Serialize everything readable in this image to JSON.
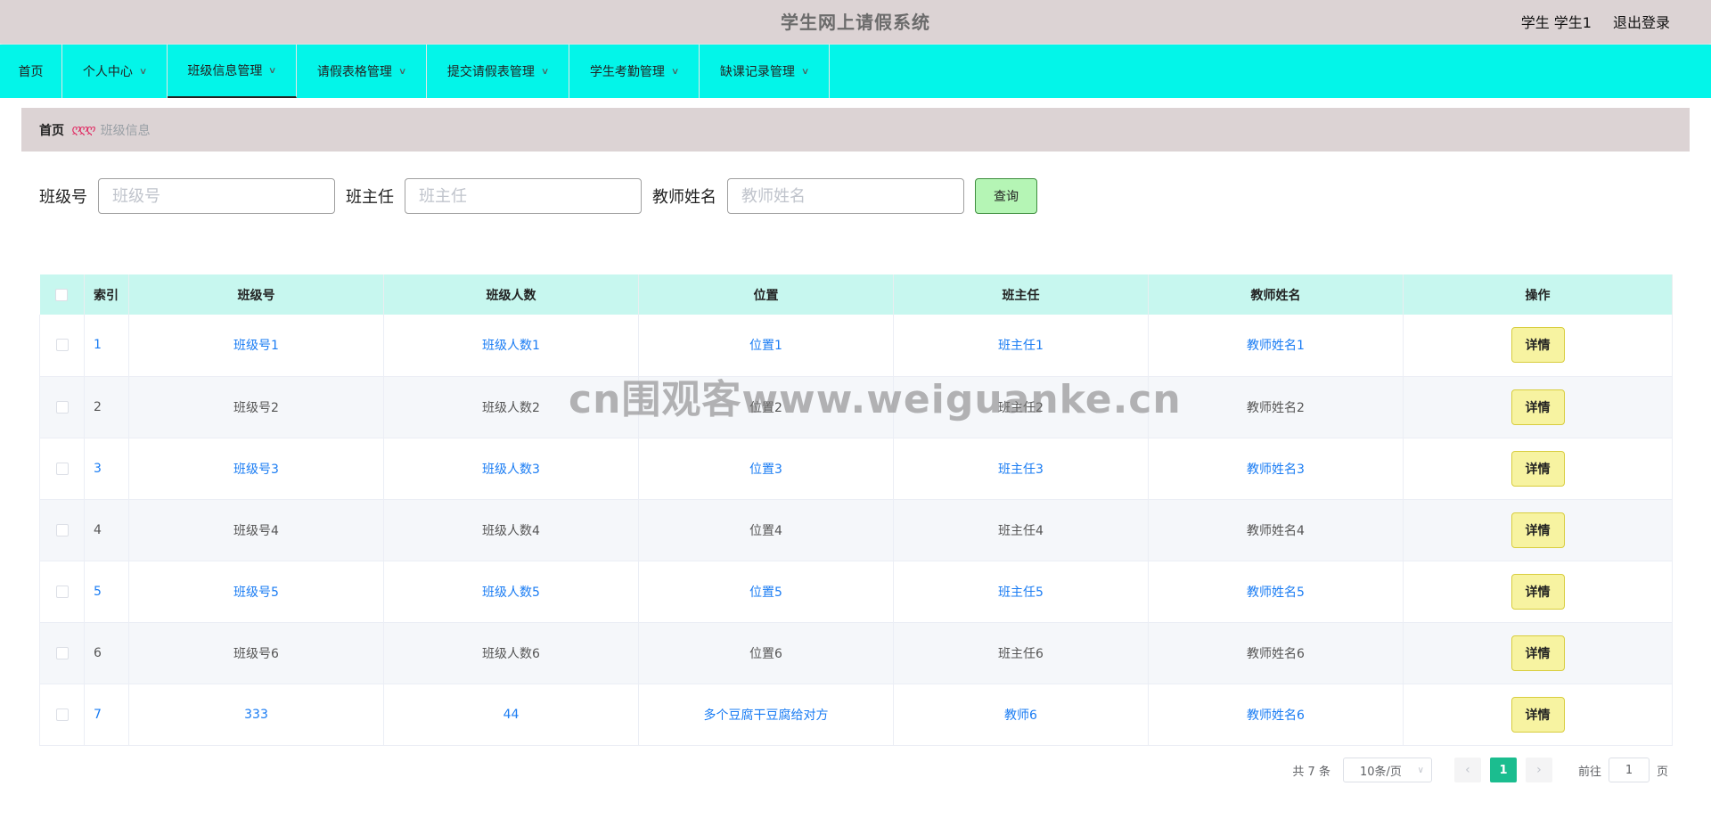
{
  "header": {
    "title": "学生网上请假系统",
    "user": "学生 学生1",
    "logout": "退出登录"
  },
  "nav": {
    "items": [
      {
        "label": "首页",
        "has_dropdown": false
      },
      {
        "label": "个人中心",
        "has_dropdown": true
      },
      {
        "label": "班级信息管理",
        "has_dropdown": true,
        "active": true
      },
      {
        "label": "请假表格管理",
        "has_dropdown": true
      },
      {
        "label": "提交请假表管理",
        "has_dropdown": true
      },
      {
        "label": "学生考勤管理",
        "has_dropdown": true
      },
      {
        "label": "缺课记录管理",
        "has_dropdown": true
      }
    ]
  },
  "breadcrumb": {
    "home": "首页",
    "separator": "ღღღ",
    "current": "班级信息"
  },
  "search": {
    "fields": [
      {
        "label": "班级号",
        "placeholder": "班级号",
        "value": ""
      },
      {
        "label": "班主任",
        "placeholder": "班主任",
        "value": ""
      },
      {
        "label": "教师姓名",
        "placeholder": "教师姓名",
        "value": ""
      }
    ],
    "button": "查询"
  },
  "table": {
    "columns": [
      "索引",
      "班级号",
      "班级人数",
      "位置",
      "班主任",
      "教师姓名",
      "操作"
    ],
    "action_label": "详情",
    "rows": [
      {
        "index": "1",
        "class_no": "班级号1",
        "count": "班级人数1",
        "location": "位置1",
        "head_teacher": "班主任1",
        "teacher_name": "教师姓名1"
      },
      {
        "index": "2",
        "class_no": "班级号2",
        "count": "班级人数2",
        "location": "位置2",
        "head_teacher": "班主任2",
        "teacher_name": "教师姓名2"
      },
      {
        "index": "3",
        "class_no": "班级号3",
        "count": "班级人数3",
        "location": "位置3",
        "head_teacher": "班主任3",
        "teacher_name": "教师姓名3"
      },
      {
        "index": "4",
        "class_no": "班级号4",
        "count": "班级人数4",
        "location": "位置4",
        "head_teacher": "班主任4",
        "teacher_name": "教师姓名4"
      },
      {
        "index": "5",
        "class_no": "班级号5",
        "count": "班级人数5",
        "location": "位置5",
        "head_teacher": "班主任5",
        "teacher_name": "教师姓名5"
      },
      {
        "index": "6",
        "class_no": "班级号6",
        "count": "班级人数6",
        "location": "位置6",
        "head_teacher": "班主任6",
        "teacher_name": "教师姓名6"
      },
      {
        "index": "7",
        "class_no": "333",
        "count": "44",
        "location": "多个豆腐干豆腐给对方",
        "head_teacher": "教师6",
        "teacher_name": "教师姓名6"
      }
    ]
  },
  "pagination": {
    "total": "共 7 条",
    "page_size": "10条/页",
    "current_page": "1",
    "goto_label": "前往",
    "goto_value": "1",
    "page_suffix": "页"
  },
  "watermark": "cn围观客www.weiguanke.cn",
  "colors": {
    "header_bg": "#dcd3d4",
    "nav_bg": "#03f5e9",
    "table_header_bg": "#c7f7ef",
    "link_blue": "#1a7cf3",
    "query_button_bg": "#b5f5b5",
    "detail_button_bg": "#f7f3a1",
    "pager_active": "#1bbd8f"
  }
}
